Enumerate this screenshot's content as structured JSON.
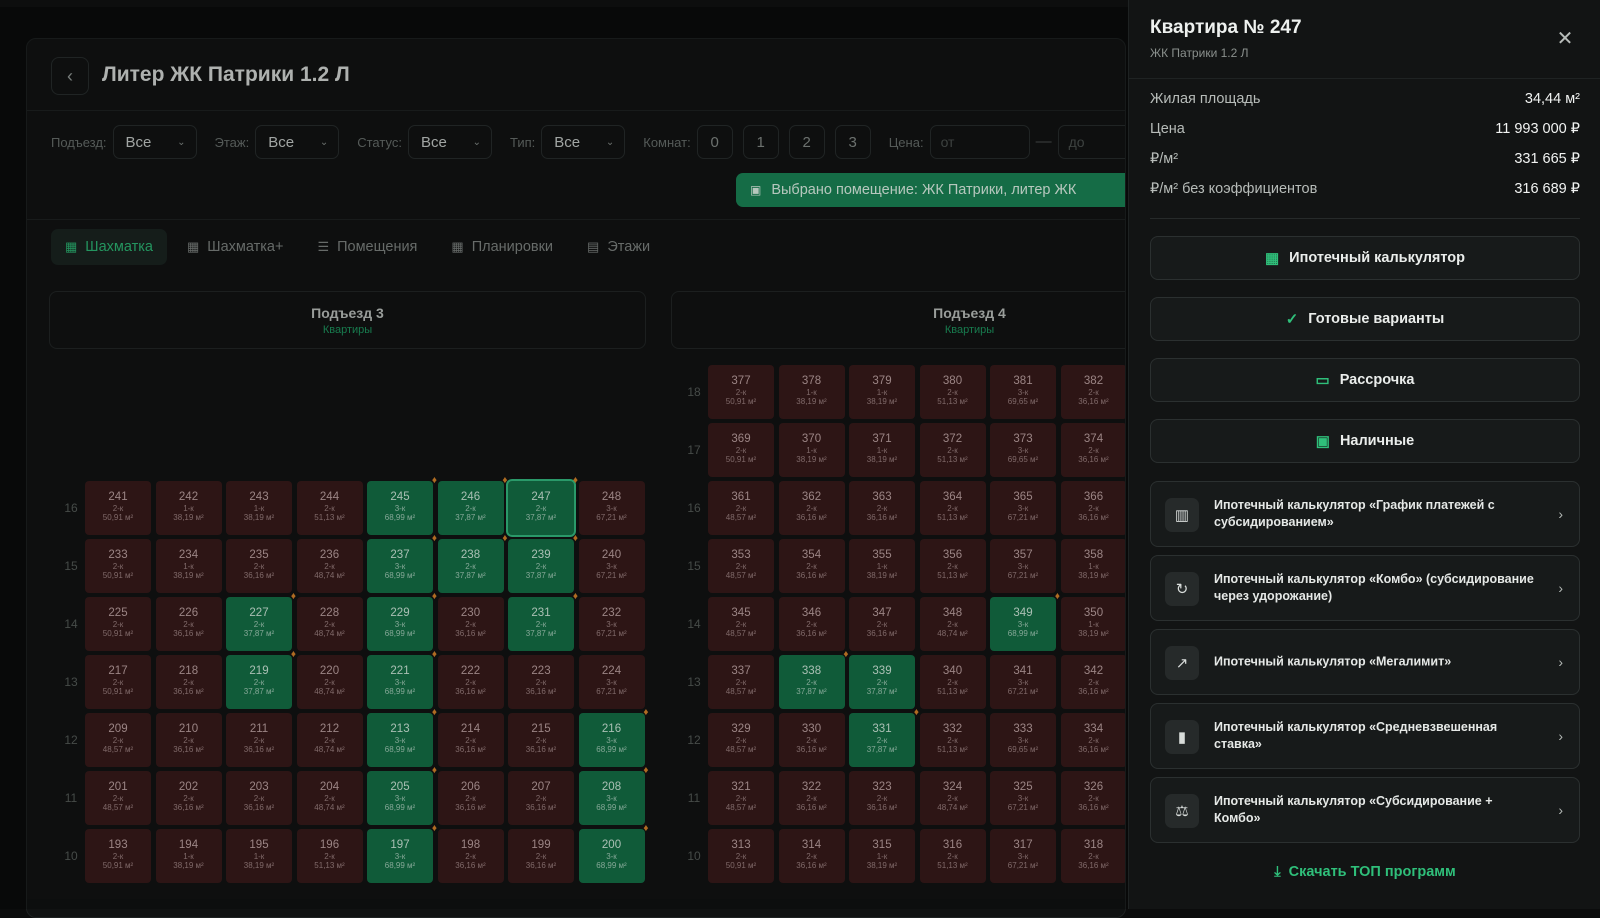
{
  "header": {
    "back_icon": "chevron-left-icon",
    "title": "Литер ЖК Патрики 1.2 Л"
  },
  "filters": {
    "entrance_label": "Подъезд:",
    "entrance_value": "Все",
    "floor_label": "Этаж:",
    "floor_value": "Все",
    "status_label": "Статус:",
    "status_value": "Все",
    "type_label": "Тип:",
    "type_value": "Все",
    "rooms_label": "Комнат:",
    "rooms": [
      "0",
      "1",
      "2",
      "3"
    ],
    "price_label": "Цена:",
    "price_from_placeholder": "от",
    "price_to_placeholder": "до"
  },
  "toast": {
    "text": "Выбрано помещение: ЖК Патрики, литер ЖК"
  },
  "tabs": [
    {
      "label": "Шахматка",
      "icon": "grid-icon",
      "active": true
    },
    {
      "label": "Шахматка+",
      "icon": "grid-plus-icon"
    },
    {
      "label": "Помещения",
      "icon": "list-icon"
    },
    {
      "label": "Планировки",
      "icon": "layout-icon"
    },
    {
      "label": "Этажи",
      "icon": "layers-icon"
    }
  ],
  "entrances": [
    {
      "name": "Подъезд 3",
      "sub": "Квартиры"
    },
    {
      "name": "Подъезд 4",
      "sub": "Квартиры"
    }
  ],
  "floors_left": [
    "16",
    "15",
    "14",
    "13",
    "12",
    "11",
    "10"
  ],
  "floors_right": [
    "18",
    "17",
    "16",
    "15",
    "14",
    "13",
    "12",
    "11",
    "10"
  ],
  "grid_left": [
    [
      [
        "241",
        "2-к",
        "50,91 м²",
        0,
        0
      ],
      [
        "242",
        "1-к",
        "38,19 м²",
        0,
        0
      ],
      [
        "243",
        "1-к",
        "38,19 м²",
        0,
        0
      ],
      [
        "244",
        "2-к",
        "51,13 м²",
        0,
        0
      ],
      [
        "245",
        "3-к",
        "68,99 м²",
        1,
        1
      ],
      [
        "246",
        "2-к",
        "37,87 м²",
        1,
        1
      ],
      [
        "247",
        "2-к",
        "37,87 м²",
        2,
        1
      ],
      [
        "248",
        "3-к",
        "67,21 м²",
        0,
        0
      ]
    ],
    [
      [
        "233",
        "2-к",
        "50,91 м²",
        0,
        0
      ],
      [
        "234",
        "1-к",
        "38,19 м²",
        0,
        0
      ],
      [
        "235",
        "2-к",
        "36,16 м²",
        0,
        0
      ],
      [
        "236",
        "2-к",
        "48,74 м²",
        0,
        0
      ],
      [
        "237",
        "3-к",
        "68,99 м²",
        1,
        1
      ],
      [
        "238",
        "2-к",
        "37,87 м²",
        1,
        1
      ],
      [
        "239",
        "2-к",
        "37,87 м²",
        1,
        1
      ],
      [
        "240",
        "3-к",
        "67,21 м²",
        0,
        0
      ]
    ],
    [
      [
        "225",
        "2-к",
        "50,91 м²",
        0,
        0
      ],
      [
        "226",
        "2-к",
        "36,16 м²",
        0,
        0
      ],
      [
        "227",
        "2-к",
        "37,87 м²",
        1,
        1
      ],
      [
        "228",
        "2-к",
        "48,74 м²",
        0,
        0
      ],
      [
        "229",
        "3-к",
        "68,99 м²",
        1,
        1
      ],
      [
        "230",
        "2-к",
        "36,16 м²",
        0,
        0
      ],
      [
        "231",
        "2-к",
        "37,87 м²",
        1,
        1
      ],
      [
        "232",
        "3-к",
        "67,21 м²",
        0,
        0
      ]
    ],
    [
      [
        "217",
        "2-к",
        "50,91 м²",
        0,
        0
      ],
      [
        "218",
        "2-к",
        "36,16 м²",
        0,
        0
      ],
      [
        "219",
        "2-к",
        "37,87 м²",
        1,
        1
      ],
      [
        "220",
        "2-к",
        "48,74 м²",
        0,
        0
      ],
      [
        "221",
        "3-к",
        "68,99 м²",
        1,
        1
      ],
      [
        "222",
        "2-к",
        "36,16 м²",
        0,
        0
      ],
      [
        "223",
        "2-к",
        "36,16 м²",
        0,
        0
      ],
      [
        "224",
        "3-к",
        "67,21 м²",
        0,
        0
      ]
    ],
    [
      [
        "209",
        "2-к",
        "48,57 м²",
        0,
        0
      ],
      [
        "210",
        "2-к",
        "36,16 м²",
        0,
        0
      ],
      [
        "211",
        "2-к",
        "36,16 м²",
        0,
        0
      ],
      [
        "212",
        "2-к",
        "48,74 м²",
        0,
        0
      ],
      [
        "213",
        "3-к",
        "68,99 м²",
        1,
        1
      ],
      [
        "214",
        "2-к",
        "36,16 м²",
        0,
        0
      ],
      [
        "215",
        "2-к",
        "36,16 м²",
        0,
        0
      ],
      [
        "216",
        "3-к",
        "68,99 м²",
        1,
        1
      ]
    ],
    [
      [
        "201",
        "2-к",
        "48,57 м²",
        0,
        0
      ],
      [
        "202",
        "2-к",
        "36,16 м²",
        0,
        0
      ],
      [
        "203",
        "2-к",
        "36,16 м²",
        0,
        0
      ],
      [
        "204",
        "2-к",
        "48,74 м²",
        0,
        0
      ],
      [
        "205",
        "3-к",
        "68,99 м²",
        1,
        1
      ],
      [
        "206",
        "2-к",
        "36,16 м²",
        0,
        0
      ],
      [
        "207",
        "2-к",
        "36,16 м²",
        0,
        0
      ],
      [
        "208",
        "3-к",
        "68,99 м²",
        1,
        1
      ]
    ],
    [
      [
        "193",
        "2-к",
        "50,91 м²",
        0,
        0
      ],
      [
        "194",
        "1-к",
        "38,19 м²",
        0,
        0
      ],
      [
        "195",
        "1-к",
        "38,19 м²",
        0,
        0
      ],
      [
        "196",
        "2-к",
        "51,13 м²",
        0,
        0
      ],
      [
        "197",
        "3-к",
        "68,99 м²",
        1,
        1
      ],
      [
        "198",
        "2-к",
        "36,16 м²",
        0,
        0
      ],
      [
        "199",
        "2-к",
        "36,16 м²",
        0,
        0
      ],
      [
        "200",
        "3-к",
        "68,99 м²",
        1,
        1
      ]
    ]
  ],
  "grid_right": [
    [
      [
        "377",
        "2-к",
        "50,91 м²",
        0,
        0
      ],
      [
        "378",
        "1-к",
        "38,19 м²",
        0,
        0
      ],
      [
        "379",
        "1-к",
        "38,19 м²",
        0,
        0
      ],
      [
        "380",
        "2-к",
        "51,13 м²",
        0,
        0
      ],
      [
        "381",
        "3-к",
        "69,65 м²",
        0,
        0
      ],
      [
        "382",
        "2-к",
        "36,16 м²",
        0,
        0
      ]
    ],
    [
      [
        "369",
        "2-к",
        "50,91 м²",
        0,
        0
      ],
      [
        "370",
        "1-к",
        "38,19 м²",
        0,
        0
      ],
      [
        "371",
        "1-к",
        "38,19 м²",
        0,
        0
      ],
      [
        "372",
        "2-к",
        "51,13 м²",
        0,
        0
      ],
      [
        "373",
        "3-к",
        "69,65 м²",
        0,
        0
      ],
      [
        "374",
        "2-к",
        "36,16 м²",
        0,
        0
      ]
    ],
    [
      [
        "361",
        "2-к",
        "48,57 м²",
        0,
        0
      ],
      [
        "362",
        "2-к",
        "36,16 м²",
        0,
        0
      ],
      [
        "363",
        "2-к",
        "36,16 м²",
        0,
        0
      ],
      [
        "364",
        "2-к",
        "51,13 м²",
        0,
        0
      ],
      [
        "365",
        "3-к",
        "67,21 м²",
        0,
        0
      ],
      [
        "366",
        "2-к",
        "36,16 м²",
        0,
        0
      ]
    ],
    [
      [
        "353",
        "2-к",
        "48,57 м²",
        0,
        0
      ],
      [
        "354",
        "2-к",
        "36,16 м²",
        0,
        0
      ],
      [
        "355",
        "1-к",
        "38,19 м²",
        0,
        0
      ],
      [
        "356",
        "2-к",
        "51,13 м²",
        0,
        0
      ],
      [
        "357",
        "3-к",
        "67,21 м²",
        0,
        0
      ],
      [
        "358",
        "1-к",
        "38,19 м²",
        0,
        0
      ]
    ],
    [
      [
        "345",
        "2-к",
        "48,57 м²",
        0,
        0
      ],
      [
        "346",
        "2-к",
        "36,16 м²",
        0,
        0
      ],
      [
        "347",
        "2-к",
        "36,16 м²",
        0,
        0
      ],
      [
        "348",
        "2-к",
        "48,74 м²",
        0,
        0
      ],
      [
        "349",
        "3-к",
        "68,99 м²",
        1,
        1
      ],
      [
        "350",
        "1-к",
        "38,19 м²",
        0,
        0
      ]
    ],
    [
      [
        "337",
        "2-к",
        "48,57 м²",
        0,
        0
      ],
      [
        "338",
        "2-к",
        "37,87 м²",
        1,
        1
      ],
      [
        "339",
        "2-к",
        "37,87 м²",
        1,
        0
      ],
      [
        "340",
        "2-к",
        "51,13 м²",
        0,
        0
      ],
      [
        "341",
        "3-к",
        "67,21 м²",
        0,
        0
      ],
      [
        "342",
        "2-к",
        "36,16 м²",
        0,
        0
      ]
    ],
    [
      [
        "329",
        "2-к",
        "48,57 м²",
        0,
        0
      ],
      [
        "330",
        "2-к",
        "36,16 м²",
        0,
        0
      ],
      [
        "331",
        "2-к",
        "37,87 м²",
        1,
        1
      ],
      [
        "332",
        "2-к",
        "51,13 м²",
        0,
        0
      ],
      [
        "333",
        "3-к",
        "69,65 м²",
        0,
        0
      ],
      [
        "334",
        "2-к",
        "36,16 м²",
        0,
        0
      ]
    ],
    [
      [
        "321",
        "2-к",
        "48,57 м²",
        0,
        0
      ],
      [
        "322",
        "2-к",
        "36,16 м²",
        0,
        0
      ],
      [
        "323",
        "2-к",
        "36,16 м²",
        0,
        0
      ],
      [
        "324",
        "2-к",
        "48,74 м²",
        0,
        0
      ],
      [
        "325",
        "3-к",
        "67,21 м²",
        0,
        0
      ],
      [
        "326",
        "2-к",
        "36,16 м²",
        0,
        0
      ]
    ],
    [
      [
        "313",
        "2-к",
        "50,91 м²",
        0,
        0
      ],
      [
        "314",
        "2-к",
        "36,16 м²",
        0,
        0
      ],
      [
        "315",
        "1-к",
        "38,19 м²",
        0,
        0
      ],
      [
        "316",
        "2-к",
        "51,13 м²",
        0,
        0
      ],
      [
        "317",
        "3-к",
        "67,21 м²",
        0,
        0
      ],
      [
        "318",
        "2-к",
        "36,16 м²",
        0,
        0
      ]
    ]
  ],
  "panel": {
    "title": "Квартира № 247",
    "subtitle": "ЖК Патрики 1.2 Л",
    "close_icon": "close-icon",
    "details": [
      {
        "label": "Жилая площадь",
        "value": "34,44 м²"
      },
      {
        "label": "Цена",
        "value": "11 993 000 ₽"
      },
      {
        "label": "₽/м²",
        "value": "331 665 ₽"
      },
      {
        "label": "₽/м² без коэффициентов",
        "value": "316 689 ₽"
      }
    ],
    "buttons": [
      {
        "label": "Ипотечный калькулятор",
        "icon": "calculator-icon"
      },
      {
        "label": "Готовые варианты",
        "icon": "check-icon"
      },
      {
        "label": "Рассрочка",
        "icon": "card-icon"
      },
      {
        "label": "Наличные",
        "icon": "cash-icon"
      }
    ],
    "programs": [
      {
        "label": "Ипотечный калькулятор «График платежей с субсидированием»",
        "icon": "chart-icon"
      },
      {
        "label": "Ипотечный калькулятор «Комбо» (субсидирование через удорожание)",
        "icon": "refresh-icon"
      },
      {
        "label": "Ипотечный калькулятор «Мегалимит»",
        "icon": "trend-up-icon"
      },
      {
        "label": "Ипотечный калькулятор «Средневзвешенная ставка»",
        "icon": "bar-chart-icon"
      },
      {
        "label": "Ипотечный калькулятор «Субсидирование + Комбо»",
        "icon": "scales-icon"
      }
    ],
    "download_label": "Скачать ТОП программ",
    "download_icon": "download-icon"
  },
  "colors": {
    "accent": "#1b8b5a",
    "available": "#15754a",
    "sold": "#3a1c1c"
  }
}
